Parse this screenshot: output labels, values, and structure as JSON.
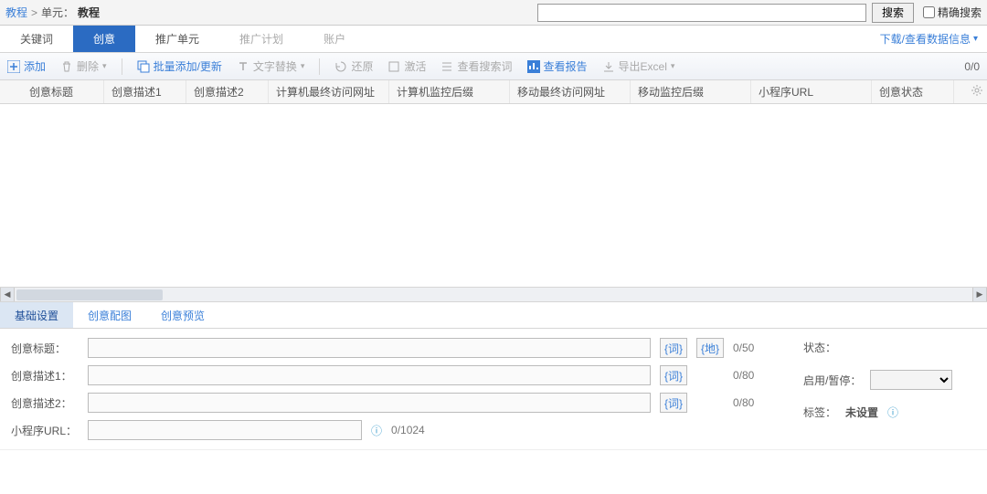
{
  "breadcrumb": {
    "link": "教程",
    "sep": ">",
    "unitlabel": "单元：",
    "unit": "教程"
  },
  "search": {
    "value": "",
    "button": "搜索",
    "exact_label": "精确搜索"
  },
  "tabs": {
    "keyword": "关键词",
    "creative": "创意",
    "adunit": "推广单元",
    "plan": "推广计划",
    "account": "账户",
    "rightlink": "下载/查看数据信息"
  },
  "toolbar": {
    "add": "添加",
    "delete": "删除",
    "batch": "批量添加/更新",
    "textreplace": "文字替换",
    "restore": "还原",
    "activate": "激活",
    "querysearch": "查看搜索词",
    "report": "查看报告",
    "export": "导出Excel",
    "count": "0/0"
  },
  "columns": {
    "c1": "创意标题",
    "c2": "创意描述1",
    "c3": "创意描述2",
    "c4": "计算机最终访问网址",
    "c5": "计算机监控后缀",
    "c6": "移动最终访问网址",
    "c7": "移动监控后缀",
    "c8": "小程序URL",
    "c9": "创意状态"
  },
  "subtabs": {
    "basic": "基础设置",
    "image": "创意配图",
    "preview": "创意预览"
  },
  "form": {
    "title_label": "创意标题：",
    "title_val": "",
    "title_count": "0/50",
    "desc1_label": "创意描述1：",
    "desc1_val": "",
    "desc1_count": "0/80",
    "desc2_label": "创意描述2：",
    "desc2_val": "",
    "desc2_count": "0/80",
    "miniurl_label": "小程序URL：",
    "miniurl_val": "",
    "miniurl_count": "0/1024",
    "ci_chip": "{词}",
    "di_chip": "{地}"
  },
  "rightpanel": {
    "status_label": "状态：",
    "status_val": "",
    "enable_label": "启用/暂停：",
    "tag_label": "标签：",
    "tag_val": "未设置"
  }
}
